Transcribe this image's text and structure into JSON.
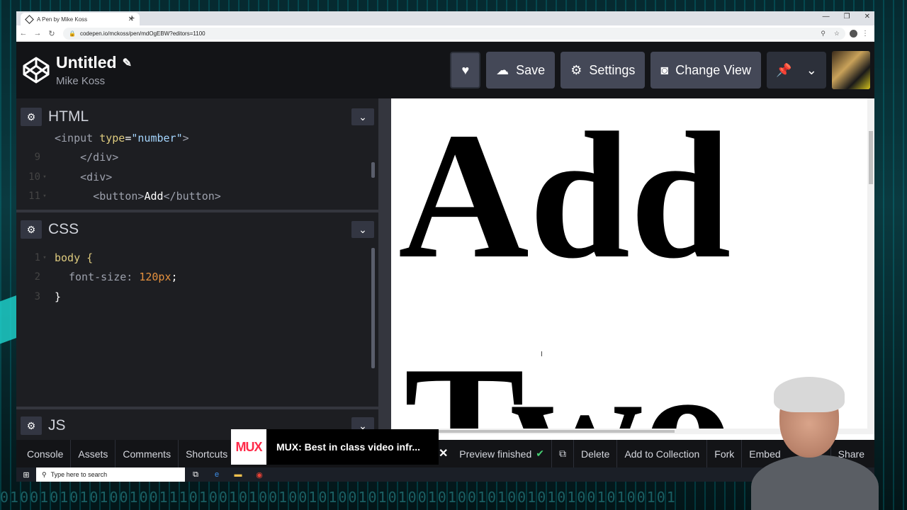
{
  "browser": {
    "tab_title": "A Pen by Mike Koss",
    "new_tab": "+",
    "url": "codepen.io/mckoss/pen/mdOgEBW?editors=1100"
  },
  "header": {
    "title": "Untitled",
    "author": "Mike Koss",
    "save_label": "Save",
    "settings_label": "Settings",
    "change_view_label": "Change View"
  },
  "editors": {
    "html": {
      "name": "HTML",
      "lines": [
        {
          "num": "",
          "indent": "",
          "tag_open": "<input ",
          "attr": "type",
          "eq": "=",
          "str": "\"number\"",
          "tag_close": ">",
          "text": ""
        },
        {
          "num": "9",
          "indent": "    ",
          "tag_open": "</div>",
          "attr": "",
          "eq": "",
          "str": "",
          "tag_close": "",
          "text": ""
        },
        {
          "num": "10",
          "indent": "    ",
          "tag_open": "<div>",
          "attr": "",
          "eq": "",
          "str": "",
          "tag_close": "",
          "text": ""
        },
        {
          "num": "11",
          "indent": "      ",
          "tag_open": "<button>",
          "attr": "",
          "eq": "",
          "str": "",
          "tag_close": "</button>",
          "text": "Add"
        }
      ]
    },
    "css": {
      "name": "CSS",
      "lines": [
        {
          "num": "1",
          "text": "body {"
        },
        {
          "num": "2",
          "prop": "font-size",
          "value": "120px"
        },
        {
          "num": "3",
          "text": "}"
        }
      ]
    },
    "js": {
      "name": "JS"
    }
  },
  "preview": {
    "word1": "Add",
    "word2": "Two"
  },
  "footer": {
    "console": "Console",
    "assets": "Assets",
    "comments": "Comments",
    "shortcuts": "Shortcuts",
    "preview_status": "Preview finished",
    "delete": "Delete",
    "add_to_collection": "Add to Collection",
    "fork": "Fork",
    "embed": "Embed",
    "share": "Share"
  },
  "toast": {
    "logo": "MUX",
    "text": "MUX: Best in class video infr..."
  },
  "taskbar": {
    "search_placeholder": "Type here to search"
  },
  "colors": {
    "codepen_bg": "#131417",
    "editor_bg": "#1d1e22",
    "button_bg": "#444857",
    "success": "#47cf73",
    "mux_red": "#ff2b4a"
  }
}
